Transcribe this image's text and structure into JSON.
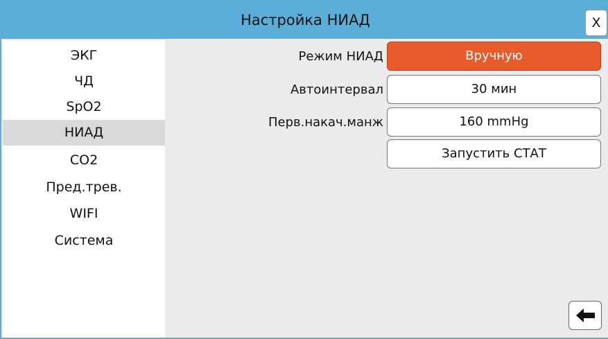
{
  "dialog": {
    "title": "Настройка НИАД",
    "close_label": "X",
    "back_icon": "arrow-left-icon"
  },
  "sidebar": {
    "selected": "НИАД",
    "items": [
      {
        "label": "ЭКГ"
      },
      {
        "label": "ЧД"
      },
      {
        "label": "SpO2"
      },
      {
        "label": "НИАД"
      },
      {
        "label": "CO2"
      },
      {
        "label": "Пред.трев."
      },
      {
        "label": "WIFI"
      },
      {
        "label": "Система"
      }
    ]
  },
  "settings": {
    "mode": {
      "label": "Режим НИАД",
      "value": "Вручную"
    },
    "auto_interval": {
      "label": "Автоинтервал",
      "value": "30 мин"
    },
    "initial_inflation": {
      "label": "Перв.накач.манж",
      "value": "160 mmHg"
    },
    "stat_button": "Запустить СТАТ"
  },
  "colors": {
    "title_bar": "#5aaed8",
    "accent": "#e85c2c",
    "selected_item": "#d9d9d9",
    "panel_bg": "#ebebeb"
  }
}
